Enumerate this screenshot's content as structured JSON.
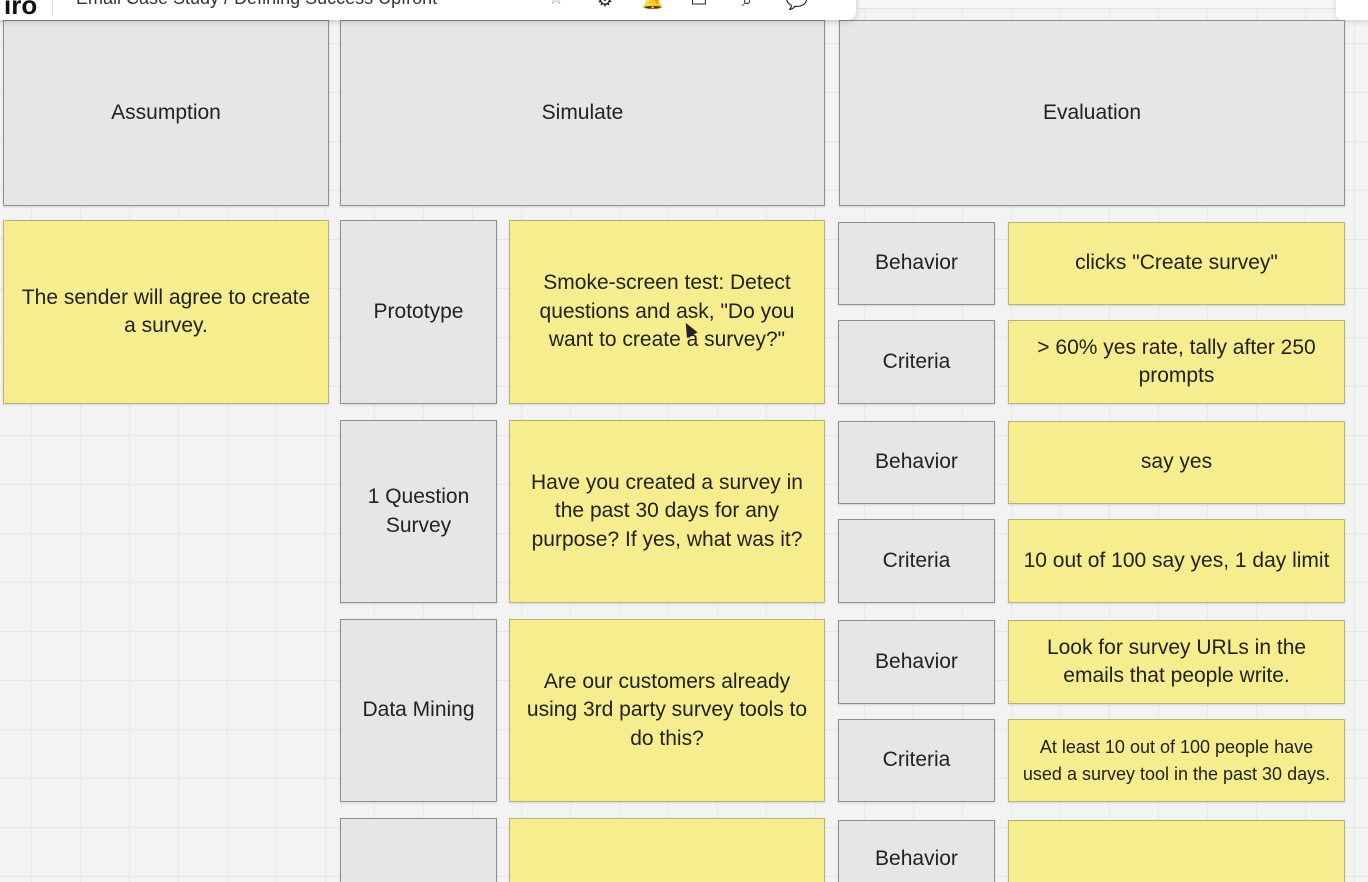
{
  "toolbar": {
    "title": "Email Case Study / Defining Success Upfront",
    "icons": [
      "settings-icon",
      "notification-icon",
      "board-icon",
      "search-icon",
      "comment-icon"
    ]
  },
  "headers": {
    "assumption": "Assumption",
    "simulate": "Simulate",
    "evaluation": "Evaluation"
  },
  "assumption": "The sender will agree to create a survey.",
  "rows": [
    {
      "method": "Prototype",
      "description": "Smoke-screen test: Detect questions and ask, \"Do you want to create a survey?\"",
      "behavior_label": "Behavior",
      "behavior": "clicks \"Create survey\"",
      "criteria_label": "Criteria",
      "criteria": "> 60% yes rate, tally after 250 prompts"
    },
    {
      "method": "1 Question Survey",
      "description": "Have you created a survey in the past 30 days for any purpose? If yes, what was it?",
      "behavior_label": "Behavior",
      "behavior": "say yes",
      "criteria_label": "Criteria",
      "criteria": "10 out of 100 say yes, 1 day limit"
    },
    {
      "method": "Data Mining",
      "description": "Are our customers already using 3rd party survey tools to do this?",
      "behavior_label": "Behavior",
      "behavior": "Look for survey URLs in the emails that people write.",
      "criteria_label": "Criteria",
      "criteria": "At least 10 out of 100 people have used a survey tool in the past 30 days."
    },
    {
      "method": "",
      "description": "",
      "behavior_label": "Behavior",
      "behavior": ""
    }
  ]
}
